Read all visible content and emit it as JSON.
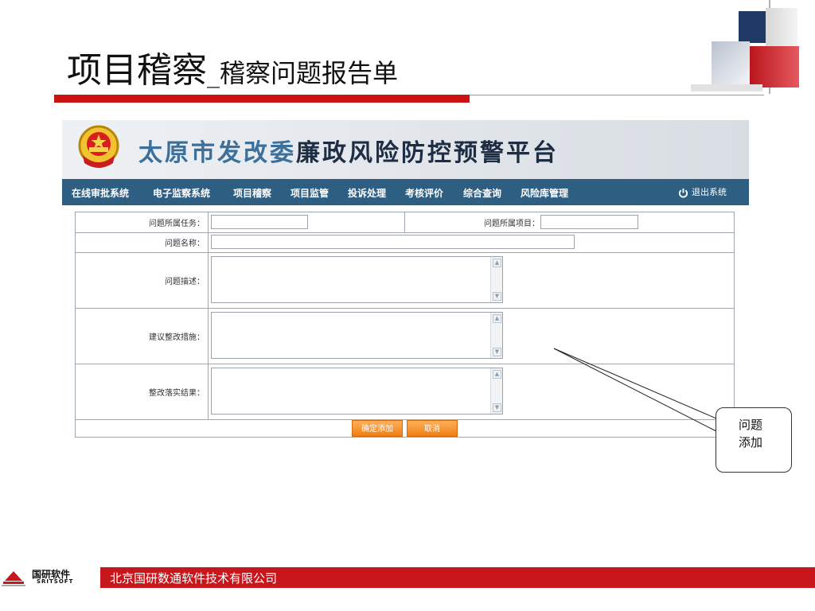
{
  "slide": {
    "title_main": "项目稽察",
    "title_sep": "_",
    "title_sub": "稽察问题报告单"
  },
  "app": {
    "banner_part1": "太原市发改委",
    "banner_part2": "廉政风险防控预警平台",
    "nav": [
      "在线审批系统",
      "电子监察系统",
      "项目稽察",
      "项目监管",
      "投诉处理",
      "考核评价",
      "综合查询",
      "风险库管理"
    ],
    "logout_label": "退出系统",
    "logout_icon": "power-icon"
  },
  "form": {
    "task_label": "问题所属任务：",
    "task_value": "",
    "project_label": "问题所属项目：",
    "project_value": "",
    "name_label": "问题名称：",
    "name_value": "",
    "desc_label": "问题描述：",
    "desc_value": "",
    "suggest_label": "建议整改措施：",
    "suggest_value": "",
    "result_label": "整改落实结果：",
    "result_value": "",
    "confirm_label": "确定添加",
    "cancel_label": "取消"
  },
  "callout": {
    "line1": "问题",
    "line2": "添加"
  },
  "footer": {
    "logo_text_cn": "国研软件",
    "logo_text_en": "SRITSOFT",
    "company": "北京国研数通软件技术有限公司"
  },
  "colors": {
    "accent_red": "#c8161d",
    "nav_blue": "#2e5f83",
    "button_orange": "#f07e12"
  }
}
